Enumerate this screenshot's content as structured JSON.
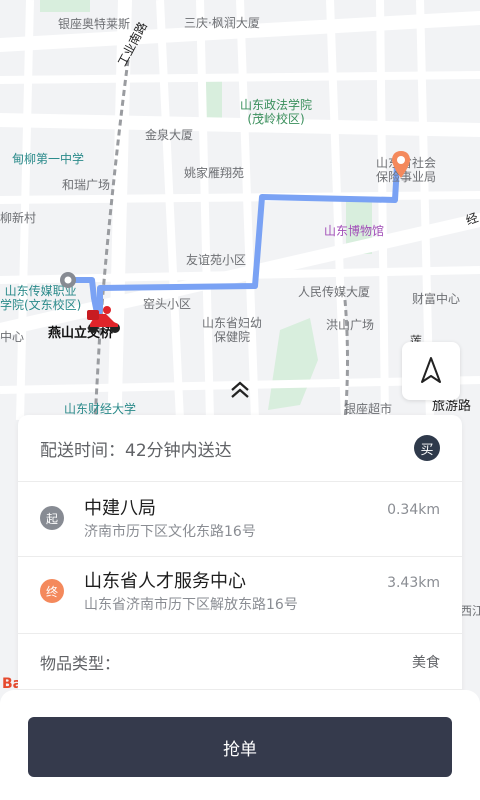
{
  "map": {
    "labels": {
      "yinzuo_aotelaisi": "银座奥特莱斯",
      "sanqing_fengluo": "三庆·枫润大厦",
      "gongye_nanlu": "工业南路",
      "shandong_zhengfa": "山东政法学院\n(茂岭校区)",
      "jinquan": "金泉大厦",
      "dianliu_zhongxue": "甸柳第一中学",
      "hexiang": "和瑞广场",
      "yaojia": "姚家雁翔苑",
      "shandong_shehui": "山东省社会\n保险事业局",
      "liu_xincun": "柳新村",
      "shandong_bowuguan": "山东博物馆",
      "youyiyuan": "友谊苑小区",
      "chuanmei": "山东传媒职业\n学院(文东校区)",
      "zhongxin": "中心",
      "yanshan": "燕山立交桥",
      "wotou": "窑头小区",
      "renmin": "人民传媒大厦",
      "caifu": "财富中心",
      "fuyou": "山东省妇幼\n保健院",
      "hongjia": "洪山广场",
      "caijing": "山东财经大学",
      "yinzuo_chaoshi": "银座超市",
      "lvyou": "旅游路",
      "xijiang": "西江",
      "baidu": "Ba",
      "jing": "经",
      "lian": "莲"
    }
  },
  "order": {
    "delivery_time": "配送时间：42分钟内送达",
    "buy_badge": "买",
    "pickup": {
      "icon_text": "起",
      "name": "中建八局",
      "address": "济南市历下区文化东路16号",
      "distance": "0.34km"
    },
    "dropoff": {
      "icon_text": "终",
      "name": "山东省人才服务中心",
      "address": "山东省济南市历下区解放东路16号",
      "distance": "3.43km"
    },
    "item_type_label": "物品类型：",
    "item_type_value": "美食"
  },
  "actions": {
    "grab_order": "抢单"
  },
  "colors": {
    "route": "#7aa2f4",
    "button": "#353a4c",
    "end_marker": "#f4895c",
    "start_marker": "#878b93"
  }
}
